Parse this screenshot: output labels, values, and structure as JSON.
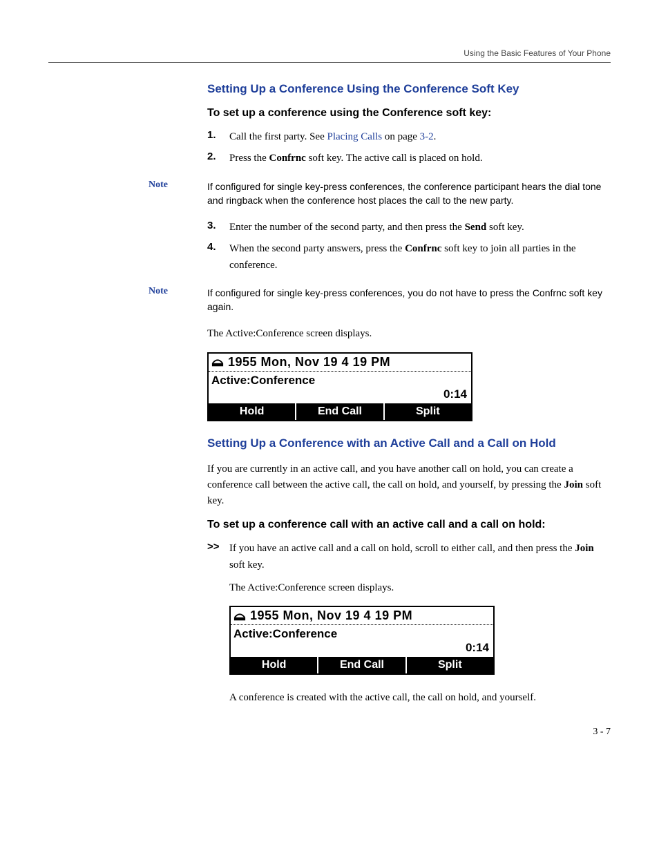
{
  "header": {
    "running_title": "Using the Basic Features of Your Phone"
  },
  "section1": {
    "heading": "Setting Up a Conference Using the Conference Soft Key",
    "intro": "To set up a conference using the Conference soft key:",
    "steps": [
      {
        "num": "1.",
        "before": "Call the first party. See ",
        "link": "Placing Calls",
        "after": " on page ",
        "page_ref": "3-2",
        "tail": "."
      },
      {
        "num": "2.",
        "before": "Press the ",
        "bold": "Confrnc",
        "after": " soft key. The active call is placed on hold."
      }
    ],
    "note1": {
      "label": "Note",
      "text": "If configured for single key-press conferences, the conference participant hears the dial tone and ringback when the conference host places the call to the new party."
    },
    "steps2": [
      {
        "num": "3.",
        "before": "Enter the number of the second party, and then press the ",
        "bold": "Send",
        "after": " soft key."
      },
      {
        "num": "4.",
        "before": "When the second party answers, press the ",
        "bold": "Confrnc",
        "after": " soft key to join all parties in the conference."
      }
    ],
    "note2": {
      "label": "Note",
      "text": "If configured for single key-press conferences, you do not have to press the Confrnc soft key again."
    },
    "result": "The Active:Conference screen displays."
  },
  "phone1": {
    "datetime": "1955  Mon, Nov 19   4 19 PM",
    "status": "Active:Conference",
    "timer": "0:14",
    "softkeys": [
      "Hold",
      "End Call",
      "Split"
    ]
  },
  "section2": {
    "heading": "Setting Up a Conference with an Active Call and a Call on Hold",
    "para_before": "If you are currently in an active call, and you have another call on hold, you can create a conference call between the active call, the call on hold, and yourself, by pressing the ",
    "para_bold": "Join",
    "para_after": " soft key.",
    "intro": "To set up a conference call with an active call and a call on hold:",
    "arrow": ">>",
    "step_before": "If you have an active call and a call on hold, scroll to either call, and then press the ",
    "step_bold": "Join",
    "step_after": " soft key.",
    "result": "The Active:Conference screen displays.",
    "closing": "A conference is created with the active call, the call on hold, and yourself."
  },
  "phone2": {
    "datetime": "1955  Mon, Nov 19   4 19 PM",
    "status": "Active:Conference",
    "timer": "0:14",
    "softkeys": [
      "Hold",
      "End Call",
      "Split"
    ]
  },
  "footer": {
    "page_number": "3 - 7"
  }
}
